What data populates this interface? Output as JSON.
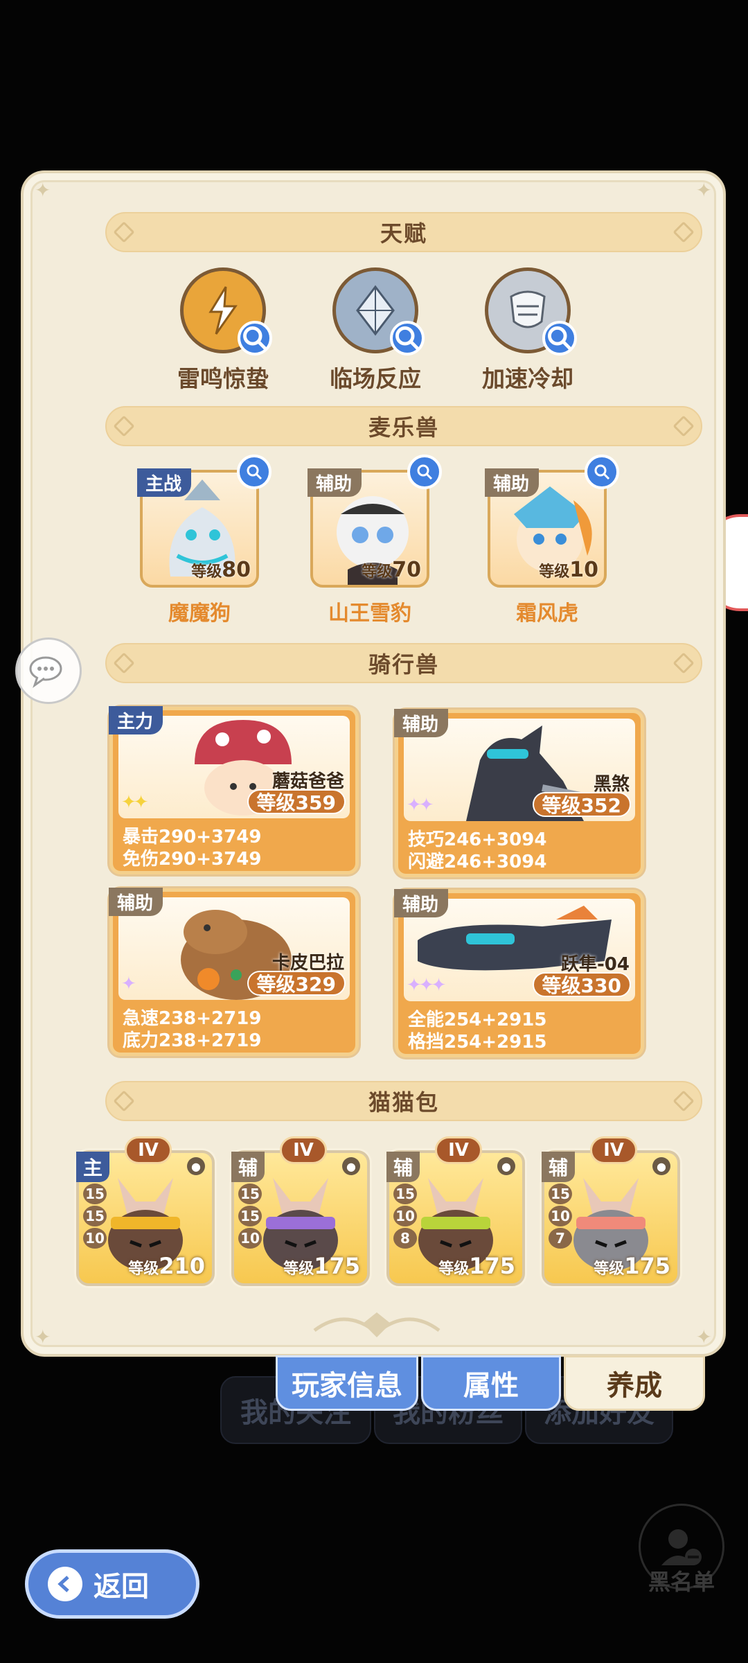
{
  "sections": {
    "talents_title": "天赋",
    "pets_title": "麦乐兽",
    "mounts_title": "骑行兽",
    "bags_title": "猫猫包"
  },
  "talents": [
    {
      "name": "雷鸣惊蛰",
      "icon": "thunder-icon",
      "color": "#e9a53a"
    },
    {
      "name": "临场反应",
      "icon": "crystal-icon",
      "color": "#9fb2c8"
    },
    {
      "name": "加速冷却",
      "icon": "armor-icon",
      "color": "#c6ccd4"
    }
  ],
  "pets": [
    {
      "role": "主战",
      "level_prefix": "等级",
      "level": "80",
      "name": "魔魔狗"
    },
    {
      "role": "辅助",
      "level_prefix": "等级",
      "level": "70",
      "name": "山王雪豹"
    },
    {
      "role": "辅助",
      "level_prefix": "等级",
      "level": "10",
      "name": "霜风虎"
    }
  ],
  "mounts": [
    {
      "role": "主力",
      "name": "蘑菇爸爸",
      "level": "等级359",
      "stat1": "暴击290+3749",
      "stat2": "免伤290+3749",
      "stars": "2"
    },
    {
      "role": "辅助",
      "name": "黑煞",
      "level": "等级352",
      "stat1": "技巧246+3094",
      "stat2": "闪避246+3094",
      "stars": "2"
    },
    {
      "role": "辅助",
      "name": "卡皮巴拉",
      "level": "等级329",
      "stat1": "急速238+2719",
      "stat2": "底力238+2719",
      "stars": "1"
    },
    {
      "role": "辅助",
      "name": "跃隼-04",
      "level": "等级330",
      "stat1": "全能254+2915",
      "stat2": "格挡254+2915",
      "stars": "3"
    }
  ],
  "bags": [
    {
      "role": "主",
      "tier": "IV",
      "nums": [
        "15",
        "15",
        "10"
      ],
      "level_prefix": "等级",
      "level": "210",
      "band": "#f0b62a"
    },
    {
      "role": "辅",
      "tier": "IV",
      "nums": [
        "15",
        "15",
        "10"
      ],
      "level_prefix": "等级",
      "level": "175",
      "band": "#9b6fd8"
    },
    {
      "role": "辅",
      "tier": "IV",
      "nums": [
        "15",
        "10",
        "8"
      ],
      "level_prefix": "等级",
      "level": "175",
      "band": "#b9d43a"
    },
    {
      "role": "辅",
      "tier": "IV",
      "nums": [
        "15",
        "10",
        "7"
      ],
      "level_prefix": "等级",
      "level": "175",
      "band": "#f08a7a"
    }
  ],
  "tabs": {
    "player_info": "玩家信息",
    "attributes": "属性",
    "cultivation": "养成"
  },
  "background": {
    "tab1": "我的关注",
    "tab2": "我的粉丝",
    "tab3": "添加好友",
    "blacklist": "黑名单"
  },
  "back_label": "返回"
}
